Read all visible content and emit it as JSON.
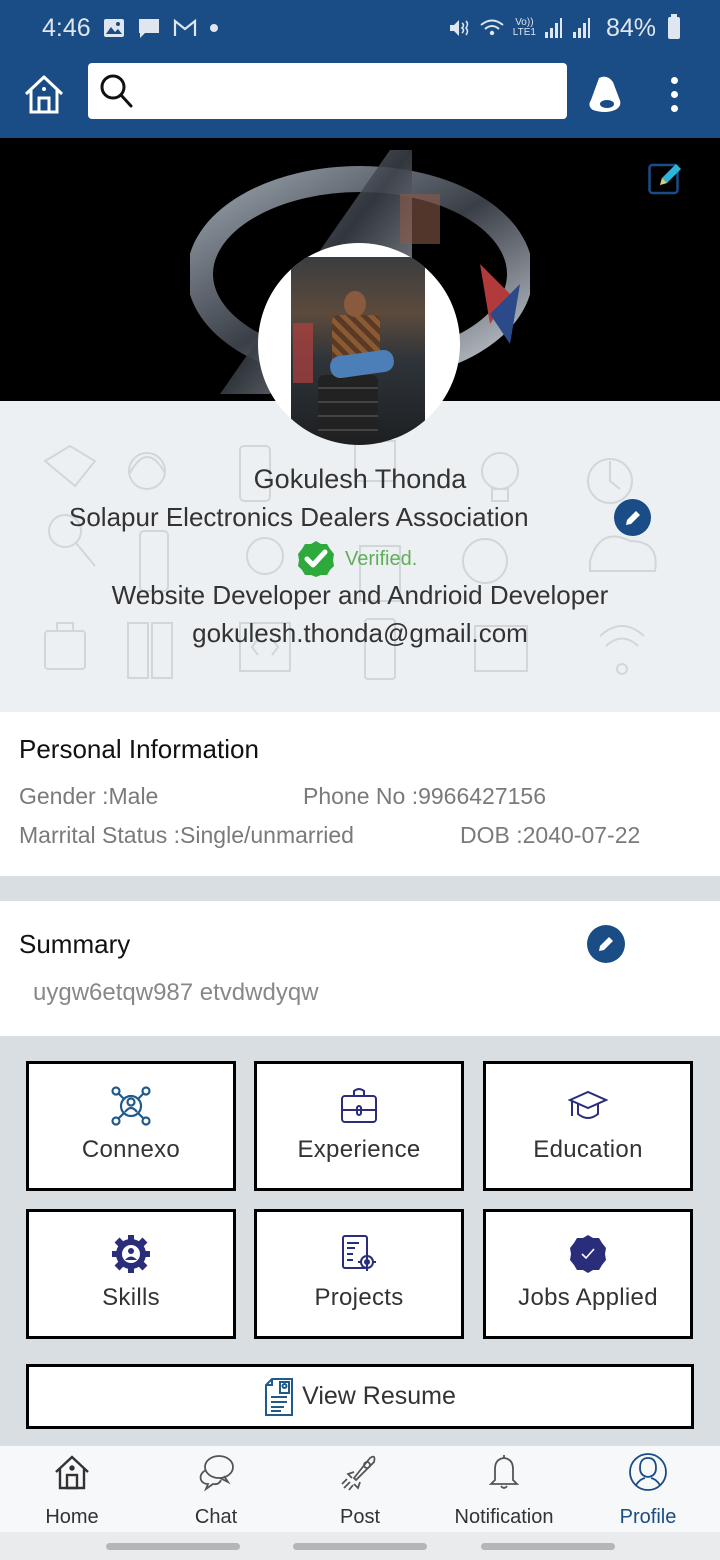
{
  "status_bar": {
    "time": "4:46",
    "left_icons": [
      "image-icon",
      "message-icon",
      "gmail-icon",
      "dot-icon"
    ],
    "right_icons": [
      "mute-icon",
      "wifi-icon",
      "volte-lte-icon",
      "signal-icon",
      "signal-icon"
    ],
    "network_label_top": "Vo))",
    "network_label_bottom": "LTE1",
    "battery": "84%"
  },
  "app_bar": {
    "search_placeholder": "",
    "search_value": "",
    "brand_color": "#1a4c85"
  },
  "profile": {
    "name": "Gokulesh Thonda",
    "organization": "Solapur Electronics Dealers Association",
    "verified_label": "Verified.",
    "role": "Website Developer and Andrioid Developer",
    "email": "gokulesh.thonda@gmail.com",
    "verified_color": "#2eaa3d"
  },
  "personal_info": {
    "title": "Personal Information",
    "gender": "Gender :Male",
    "phone": "Phone No :9966427156",
    "marital_status": "Marrital Status :Single/unmarried",
    "dob": "DOB :2040-07-22"
  },
  "summary": {
    "title": "Summary",
    "text": "uygw6etqw987 etvdwdyqw"
  },
  "tiles": [
    {
      "label": "Connexo",
      "icon": "network-icon"
    },
    {
      "label": "Experience",
      "icon": "briefcase-icon"
    },
    {
      "label": "Education",
      "icon": "graduation-cap-icon"
    },
    {
      "label": "Skills",
      "icon": "gear-user-icon"
    },
    {
      "label": "Projects",
      "icon": "blueprint-gear-icon"
    },
    {
      "label": "Jobs Applied",
      "icon": "verified-badge-icon"
    }
  ],
  "resume_button": {
    "label": "View Resume"
  },
  "bottom_nav": [
    {
      "label": "Home",
      "active": false
    },
    {
      "label": "Chat",
      "active": false
    },
    {
      "label": "Post",
      "active": false
    },
    {
      "label": "Notification",
      "active": false
    },
    {
      "label": "Profile",
      "active": true
    }
  ]
}
